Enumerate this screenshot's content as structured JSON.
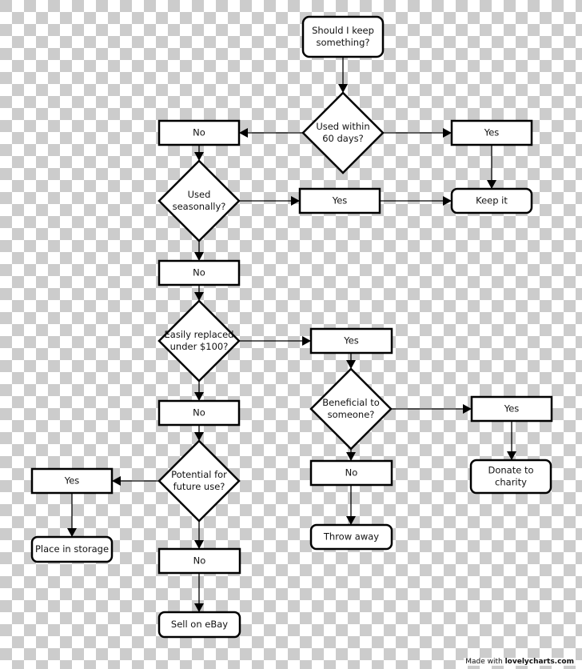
{
  "diagram": {
    "title": "Should I keep something?",
    "nodes": [
      {
        "id": "start",
        "type": "terminal",
        "label": [
          "Should I keep",
          "something?"
        ]
      },
      {
        "id": "q_used60",
        "type": "decision",
        "label": [
          "Used within",
          "60 days?"
        ]
      },
      {
        "id": "no1",
        "type": "answer",
        "label": [
          "No"
        ]
      },
      {
        "id": "yes1",
        "type": "answer",
        "label": [
          "Yes"
        ]
      },
      {
        "id": "keep",
        "type": "terminal",
        "label": [
          "Keep it"
        ]
      },
      {
        "id": "q_seasonal",
        "type": "decision",
        "label": [
          "Used",
          "seasonally?"
        ]
      },
      {
        "id": "yes2",
        "type": "answer",
        "label": [
          "Yes"
        ]
      },
      {
        "id": "no2",
        "type": "answer",
        "label": [
          "No"
        ]
      },
      {
        "id": "q_replace",
        "type": "decision",
        "label": [
          "Easily replaced",
          "under $100?"
        ]
      },
      {
        "id": "yes3",
        "type": "answer",
        "label": [
          "Yes"
        ]
      },
      {
        "id": "no3",
        "type": "answer",
        "label": [
          "No"
        ]
      },
      {
        "id": "q_benefit",
        "type": "decision",
        "label": [
          "Beneficial to",
          "someone?"
        ]
      },
      {
        "id": "yes4",
        "type": "answer",
        "label": [
          "Yes"
        ]
      },
      {
        "id": "donate",
        "type": "terminal",
        "label": [
          "Donate to",
          "charity"
        ]
      },
      {
        "id": "no4",
        "type": "answer",
        "label": [
          "No"
        ]
      },
      {
        "id": "throw",
        "type": "terminal",
        "label": [
          "Throw away"
        ]
      },
      {
        "id": "q_future",
        "type": "decision",
        "label": [
          "Potential for",
          "future use?"
        ]
      },
      {
        "id": "yes5",
        "type": "answer",
        "label": [
          "Yes"
        ]
      },
      {
        "id": "storage",
        "type": "terminal",
        "label": [
          "Place in storage"
        ]
      },
      {
        "id": "no5",
        "type": "answer",
        "label": [
          "No"
        ]
      },
      {
        "id": "ebay",
        "type": "terminal",
        "label": [
          "Sell on eBay"
        ]
      }
    ],
    "edges": [
      {
        "from": "start",
        "to": "q_used60"
      },
      {
        "from": "q_used60",
        "to": "no1"
      },
      {
        "from": "q_used60",
        "to": "yes1"
      },
      {
        "from": "yes1",
        "to": "keep"
      },
      {
        "from": "no1",
        "to": "q_seasonal"
      },
      {
        "from": "q_seasonal",
        "to": "yes2"
      },
      {
        "from": "yes2",
        "to": "keep"
      },
      {
        "from": "q_seasonal",
        "to": "no2"
      },
      {
        "from": "no2",
        "to": "q_replace"
      },
      {
        "from": "q_replace",
        "to": "yes3"
      },
      {
        "from": "q_replace",
        "to": "no3"
      },
      {
        "from": "yes3",
        "to": "q_benefit"
      },
      {
        "from": "q_benefit",
        "to": "yes4"
      },
      {
        "from": "yes4",
        "to": "donate"
      },
      {
        "from": "q_benefit",
        "to": "no4"
      },
      {
        "from": "no4",
        "to": "throw"
      },
      {
        "from": "no3",
        "to": "q_future"
      },
      {
        "from": "q_future",
        "to": "yes5"
      },
      {
        "from": "yes5",
        "to": "storage"
      },
      {
        "from": "q_future",
        "to": "no5"
      },
      {
        "from": "no5",
        "to": "ebay"
      }
    ]
  },
  "watermark": {
    "prefix": "Made with ",
    "brand": "lovelycharts.com"
  },
  "colors": {
    "stroke": "#000000",
    "fill": "#ffffff",
    "checker_gray": "#cccccc"
  }
}
